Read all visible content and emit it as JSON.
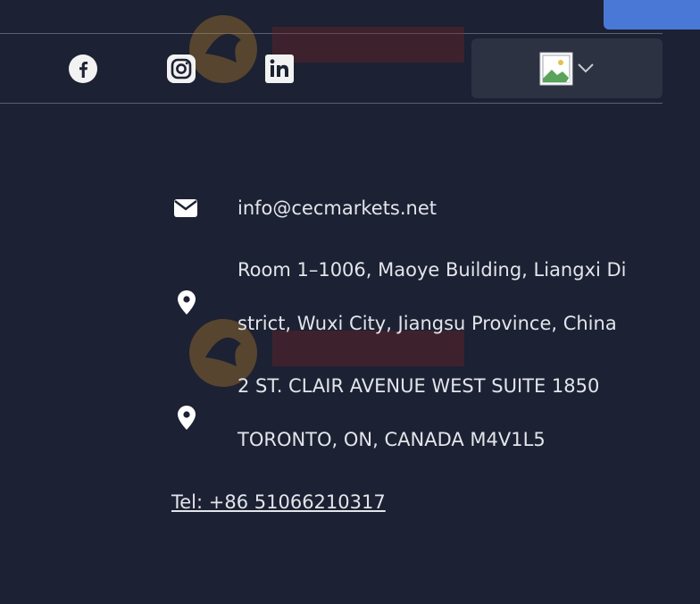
{
  "social": {
    "facebook": "facebook-icon",
    "instagram": "instagram-icon",
    "linkedin": "linkedin-icon"
  },
  "language_selector": {
    "flag_icon": "broken-image-icon",
    "dropdown_icon": "chevron-down-icon"
  },
  "contact": {
    "email": "info@cecmarkets.net",
    "address_1": {
      "line1": "Room 1–1006, Maoye Building, Liangxi Di",
      "line2": "strict, Wuxi City, Jiangsu Province, China"
    },
    "address_2": {
      "line1": "2 ST. CLAIR AVENUE WEST SUITE 1850",
      "line2": "TORONTO, ON, CANADA M4V1L5"
    },
    "tel": "Tel: +86 51066210317"
  },
  "colors": {
    "background": "#1c2133",
    "accent": "#4a78d6",
    "text": "#e3e5eb",
    "panel": "#2d3242"
  }
}
